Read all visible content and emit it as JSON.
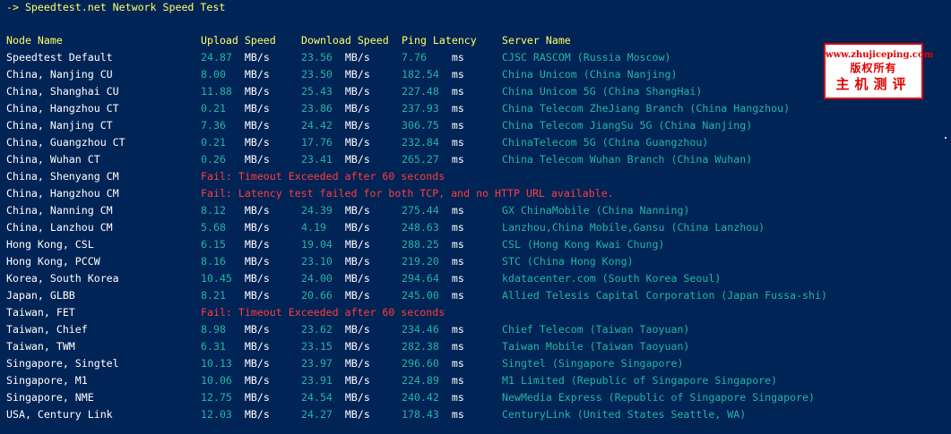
{
  "title": "-> Speedtest.net Network Speed Test",
  "headers": {
    "node": "Node Name",
    "upload": "Upload Speed",
    "download": "Download Speed",
    "ping": "Ping Latency",
    "server": "Server Name"
  },
  "units": {
    "speed": "MB/s",
    "latency": "ms"
  },
  "rows": [
    {
      "node": "Speedtest Default",
      "upload": "24.87",
      "download": "23.56",
      "ping": "7.76",
      "server": "CJSC RASCOM (Russia Moscow)"
    },
    {
      "node": "China, Nanjing CU",
      "upload": "8.00",
      "download": "23.50",
      "ping": "182.54",
      "server": "China Unicom (China Nanjing)"
    },
    {
      "node": "China, Shanghai CU",
      "upload": "11.88",
      "download": "25.43",
      "ping": "227.48",
      "server": "China Unicom 5G (China ShangHai)"
    },
    {
      "node": "China, Hangzhou CT",
      "upload": "0.21",
      "download": "23.86",
      "ping": "237.93",
      "server": "China Telecom ZheJiang Branch (China Hangzhou)"
    },
    {
      "node": "China, Nanjing CT",
      "upload": "7.36",
      "download": "24.42",
      "ping": "306.75",
      "server": "China Telecom JiangSu 5G (China Nanjing)"
    },
    {
      "node": "China, Guangzhou CT",
      "upload": "0.21",
      "download": "17.76",
      "ping": "232.84",
      "server": "ChinaTelecom 5G (China Guangzhou)"
    },
    {
      "node": "China, Wuhan CT",
      "upload": "0.26",
      "download": "23.41",
      "ping": "265.27",
      "server": "China Telecom Wuhan Branch (China Wuhan)"
    },
    {
      "node": "China, Shenyang CM",
      "fail": "Fail: Timeout Exceeded after 60 seconds"
    },
    {
      "node": "China, Hangzhou CM",
      "fail": "Fail: Latency test failed for both TCP, and no HTTP URL available."
    },
    {
      "node": "China, Nanning CM",
      "upload": "8.12",
      "download": "24.39",
      "ping": "275.44",
      "server": "GX ChinaMobile (China Nanning)"
    },
    {
      "node": "China, Lanzhou CM",
      "upload": "5.68",
      "download": "4.19",
      "ping": "248.63",
      "server": "Lanzhou,China Mobile,Gansu (China Lanzhou)"
    },
    {
      "node": "Hong Kong, CSL",
      "upload": "6.15",
      "download": "19.04",
      "ping": "288.25",
      "server": "CSL (Hong Kong Kwai Chung)"
    },
    {
      "node": "Hong Kong, PCCW",
      "upload": "8.16",
      "download": "23.10",
      "ping": "219.20",
      "server": "STC (China Hong Kong)"
    },
    {
      "node": "Korea, South Korea",
      "upload": "10.45",
      "download": "24.00",
      "ping": "294.64",
      "server": "kdatacenter.com (South Korea Seoul)"
    },
    {
      "node": "Japan, GLBB",
      "upload": "8.21",
      "download": "20.66",
      "ping": "245.00",
      "server": "Allied Telesis Capital Corporation (Japan Fussa-shi)"
    },
    {
      "node": "Taiwan, FET",
      "fail": "Fail: Timeout Exceeded after 60 seconds"
    },
    {
      "node": "Taiwan, Chief",
      "upload": "8.98",
      "download": "23.62",
      "ping": "234.46",
      "server": "Chief Telecom (Taiwan Taoyuan)"
    },
    {
      "node": "Taiwan, TWM",
      "upload": "6.31",
      "download": "23.15",
      "ping": "282.38",
      "server": "Taiwan Mobile (Taiwan Taoyuan)"
    },
    {
      "node": "Singapore, Singtel",
      "upload": "10.13",
      "download": "23.97",
      "ping": "296.60",
      "server": "Singtel (Singapore Singapore)"
    },
    {
      "node": "Singapore, M1",
      "upload": "10.06",
      "download": "23.91",
      "ping": "224.89",
      "server": "M1 Limited (Republic of Singapore Singapore)"
    },
    {
      "node": "Singapore, NME",
      "upload": "12.75",
      "download": "24.54",
      "ping": "240.42",
      "server": "NewMedia Express (Republic of Singapore Singapore)"
    },
    {
      "node": "USA, Century Link",
      "upload": "12.03",
      "download": "24.27",
      "ping": "178.43",
      "server": "CenturyLink (United States Seattle, WA)"
    }
  ],
  "watermark": {
    "url": "www.zhujiceping.com",
    "line2": "版权所有",
    "line3": "主机测评"
  },
  "colors": {
    "background": "#012456",
    "header": "#ffff66",
    "value": "#24b5a3",
    "fail": "#ff3b3b",
    "text": "#ffffff"
  }
}
